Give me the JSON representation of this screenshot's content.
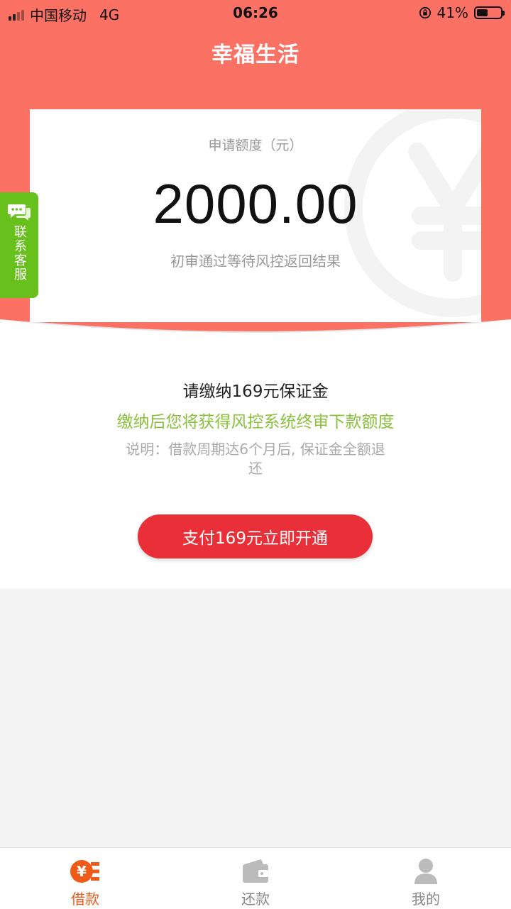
{
  "status_bar": {
    "carrier": "中国移动",
    "network": "4G",
    "time": "06:26",
    "battery": "41%"
  },
  "header": {
    "title": "幸福生活"
  },
  "card": {
    "label": "申请额度（元）",
    "amount": "2000.00",
    "status": "初审通过等待风控返回结果"
  },
  "service": {
    "label": "联系客服"
  },
  "fee": {
    "title": "请缴纳169元保证金",
    "hint": "缴纳后您将获得风控系统终审下款额度",
    "note": "说明：借款周期达6个月后, 保证金全额退还"
  },
  "pay_button": {
    "label": "支付169元立即开通"
  },
  "tabs": [
    {
      "label": "借款",
      "icon": "loan-icon",
      "active": true
    },
    {
      "label": "还款",
      "icon": "wallet-icon",
      "active": false
    },
    {
      "label": "我的",
      "icon": "user-icon",
      "active": false
    }
  ],
  "colors": {
    "header_bg": "#fb7264",
    "accent_green": "#8ac13c",
    "service_green": "#67c01c",
    "button_red": "#e92f38",
    "tab_active": "#f05a19"
  }
}
